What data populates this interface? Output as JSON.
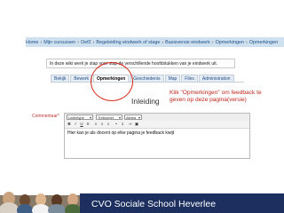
{
  "breadcrumb": [
    "Home",
    "Mijn cursussen",
    "Oef2",
    "Begeleiding eindwerk of stage",
    "Basisversie eindwerk",
    "Opmerkingen",
    "Opmerkingen"
  ],
  "intro_text": "In deze wiki werk je stap voor stap de verschillende hoofdstukken van je eindwerk uit.",
  "tabs": [
    {
      "label": "Bekijk",
      "active": false
    },
    {
      "label": "Bewerk",
      "active": false
    },
    {
      "label": "Opmerkingen",
      "active": true
    },
    {
      "label": "Geschiedenis",
      "active": false
    },
    {
      "label": "Map",
      "active": false
    },
    {
      "label": "Files",
      "active": false
    },
    {
      "label": "Administration",
      "active": false
    }
  ],
  "page_heading": "Inleiding",
  "annotation": "Klik \"Opmerkingen\" om feedback te geven op deze pagina(versie)",
  "comment_label": "Commentaar*",
  "editor": {
    "font_select": "Lettertype",
    "font_name": "Trebuchet",
    "size": "Alinea",
    "text": "Hier kan je als docent op elke pagina je feedback kwijt"
  },
  "footer_title": "CVO Sociale School Heverlee",
  "colors": {
    "accent_red": "#d7291b",
    "footer_bg": "#1c2f5f",
    "breadcrumb_bg": "#cfe0ee"
  }
}
